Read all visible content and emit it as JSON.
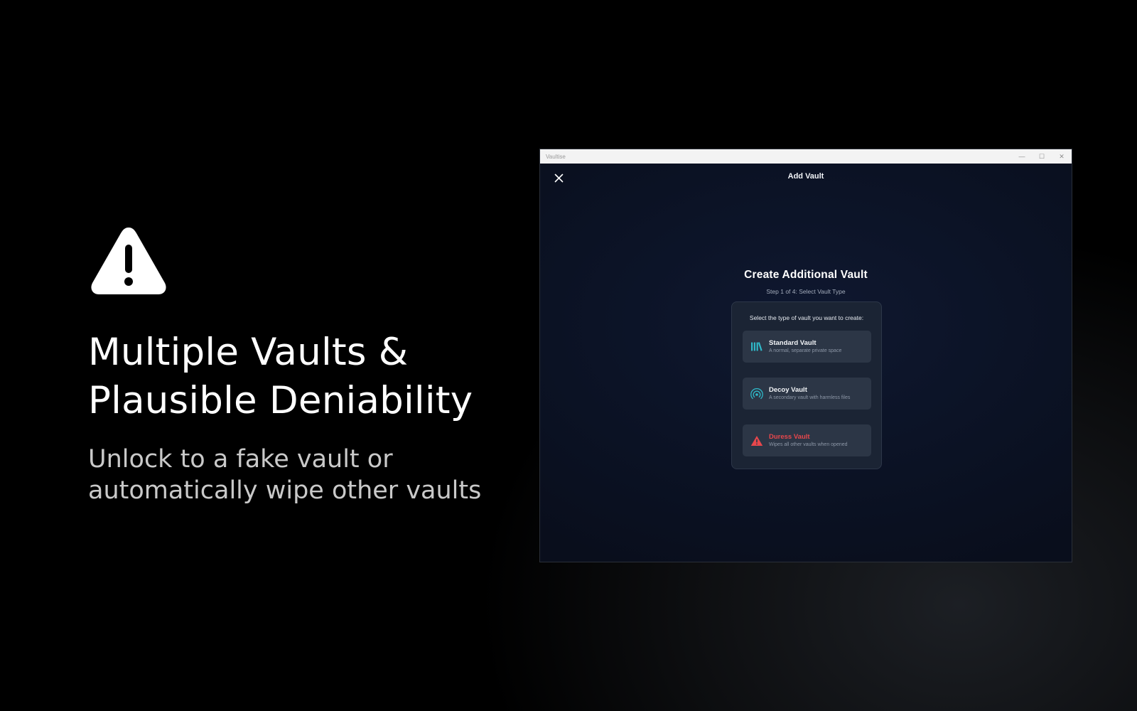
{
  "promo": {
    "icon": "warning-triangle-icon",
    "headline_line1": "Multiple Vaults &",
    "headline_line2": "Plausible Deniability",
    "subhead_line1": "Unlock to a fake vault or",
    "subhead_line2": "automatically wipe other vaults"
  },
  "window": {
    "title": "Vaultise",
    "controls": {
      "minimize": "—",
      "maximize": "☐",
      "close": "✕"
    }
  },
  "app": {
    "header_title": "Add Vault",
    "close_icon": "close-icon",
    "wizard_title": "Create Additional Vault",
    "wizard_step": "Step 1 of 4: Select Vault Type",
    "prompt": "Select the type of vault you want to create:",
    "options": [
      {
        "title": "Standard Vault",
        "description": "A normal, separate private space",
        "icon": "books-icon",
        "color": "#2fb8c8"
      },
      {
        "title": "Decoy Vault",
        "description": "A secondary vault with harmless files",
        "icon": "radar-icon",
        "color": "#2fb8c8"
      },
      {
        "title": "Duress Vault",
        "description": "Wipes all other vaults when opened",
        "icon": "warning-icon",
        "color": "#e8474c"
      }
    ]
  },
  "colors": {
    "accent_teal": "#2fb8c8",
    "danger_red": "#e8474c",
    "app_bg": "#0b1122",
    "card_bg": "#1b2434",
    "option_bg": "#2c3646"
  }
}
